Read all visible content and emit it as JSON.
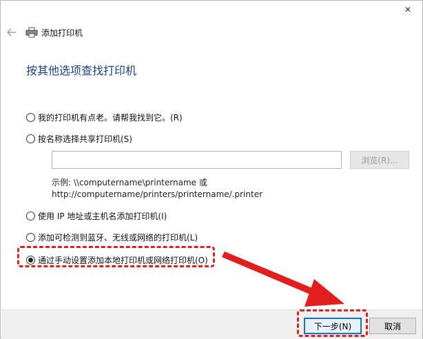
{
  "window": {
    "close_glyph": "✕"
  },
  "header": {
    "title": "添加打印机"
  },
  "heading": "按其他选项查找打印机",
  "options": [
    {
      "label": "我的打印机有点老。请帮我找到它。(R)",
      "checked": false
    },
    {
      "label": "按名称选择共享打印机(S)",
      "checked": false
    },
    {
      "label": "使用 IP 地址或主机名添加打印机(I)",
      "checked": false
    },
    {
      "label": "添加可检测到蓝牙、无线或网络的打印机(L)",
      "checked": false
    },
    {
      "label": "通过手动设置添加本地打印机或网络打印机(O)",
      "checked": true
    }
  ],
  "shared": {
    "input_value": "",
    "browse_label": "浏览(R)...",
    "example_line1": "示例: \\\\computername\\printername 或",
    "example_line2": "http://computername/printers/printername/.printer"
  },
  "footer": {
    "next_label": "下一步(N)",
    "cancel_label": "取消"
  },
  "colors": {
    "heading": "#1c3f94",
    "annotation": "#e11f1f",
    "default_button_border": "#1a6fd0"
  },
  "icons": {
    "back": "back-arrow-icon",
    "printer": "printer-icon",
    "close": "close-icon"
  }
}
